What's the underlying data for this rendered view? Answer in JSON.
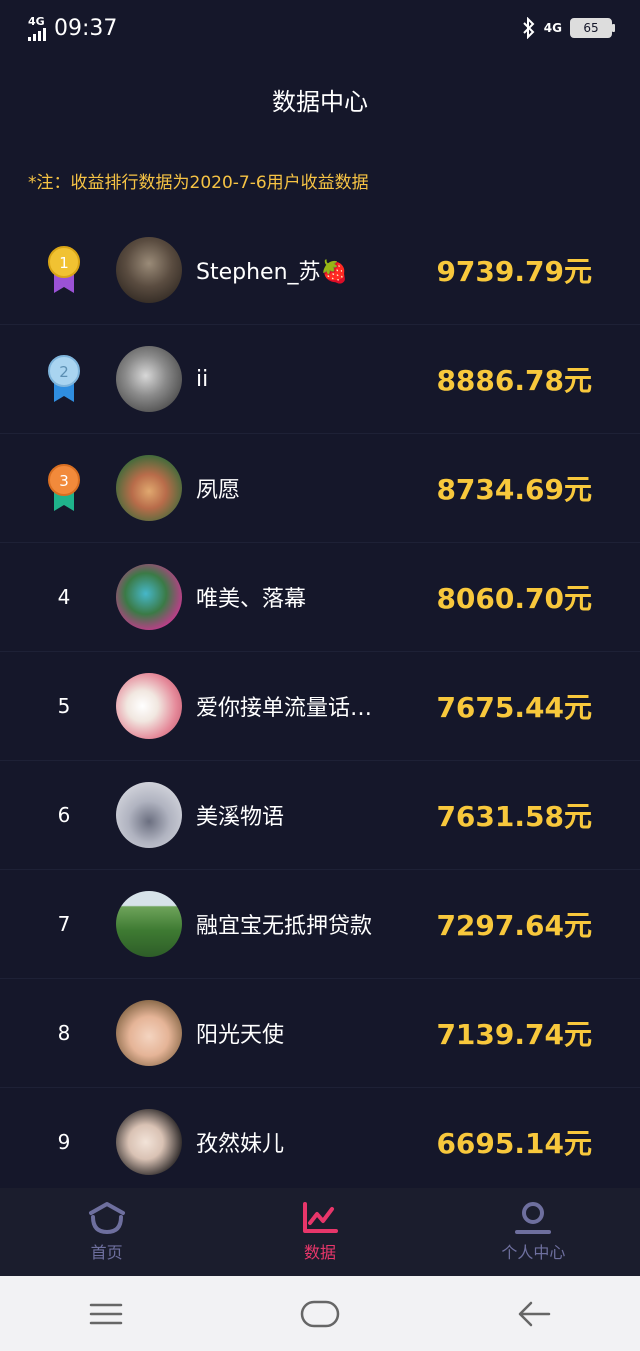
{
  "status": {
    "time": "09:37",
    "network": "4G",
    "network_right": "4G",
    "battery": "65"
  },
  "header": {
    "title": "数据中心"
  },
  "note": "*注：收益排行数据为2020-7-6用户收益数据",
  "ranking": [
    {
      "rank": "1",
      "name": "Stephen_苏🍓",
      "amount": "9739.79元",
      "medal": "gold"
    },
    {
      "rank": "2",
      "name": "ii",
      "amount": "8886.78元",
      "medal": "silver"
    },
    {
      "rank": "3",
      "name": "夙愿",
      "amount": "8734.69元",
      "medal": "bronze"
    },
    {
      "rank": "4",
      "name": "唯美、落幕",
      "amount": "8060.70元"
    },
    {
      "rank": "5",
      "name": "爱你接单流量话…",
      "amount": "7675.44元"
    },
    {
      "rank": "6",
      "name": "美溪物语",
      "amount": "7631.58元"
    },
    {
      "rank": "7",
      "name": "融宜宝无抵押贷款",
      "amount": "7297.64元"
    },
    {
      "rank": "8",
      "name": "阳光天使",
      "amount": "7139.74元"
    },
    {
      "rank": "9",
      "name": "孜然妹儿",
      "amount": "6695.14元"
    }
  ],
  "tabs": [
    {
      "label": "首页",
      "icon": "home-icon",
      "active": false
    },
    {
      "label": "数据",
      "icon": "chart-icon",
      "active": true
    },
    {
      "label": "个人中心",
      "icon": "user-icon",
      "active": false
    }
  ],
  "colors": {
    "accent": "#f8c83c",
    "active_tab": "#e8366a",
    "inactive_tab": "#6e6f9e",
    "background": "#15172a"
  }
}
